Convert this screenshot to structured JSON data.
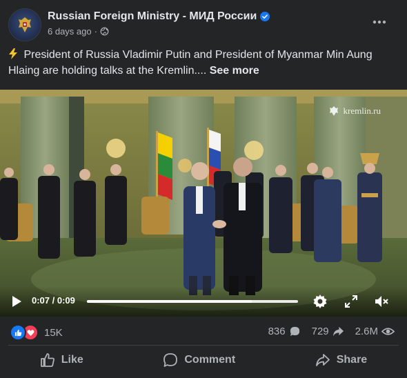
{
  "post": {
    "page_name": "Russian Foreign Ministry - МИД России",
    "time": "6 days ago",
    "caption": "President of Russia Vladimir Putin and President of Myanmar Min Aung Hlaing are holding talks at the Kremlin....",
    "see_more": "See more"
  },
  "video": {
    "watermark": "kremlin.ru",
    "time_display": "0:07 / 0:09",
    "progress": 0.78
  },
  "stats": {
    "reactions_count": "15K",
    "comments_count": "836",
    "shares_count": "729",
    "views_count": "2.6M"
  },
  "actions": {
    "like": "Like",
    "comment": "Comment",
    "share": "Share"
  },
  "colors": {
    "like_blue": "#1877f2",
    "love_red": "#f33e58",
    "verified_blue": "#1877f2"
  }
}
